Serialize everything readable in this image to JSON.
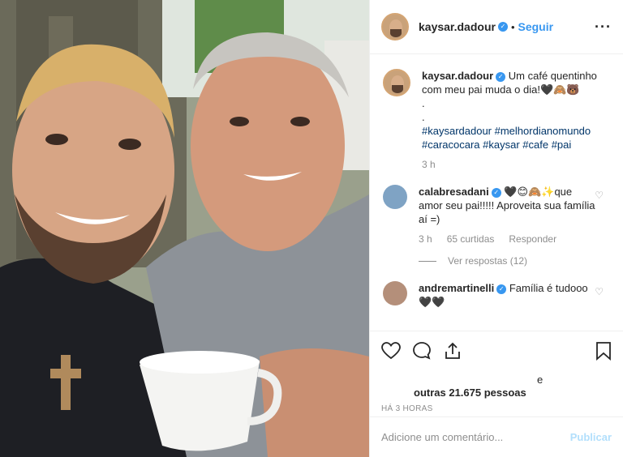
{
  "post": {
    "username": "kaysar.dadour",
    "follow_label": "Seguir",
    "more_icon": "more-icon"
  },
  "caption": {
    "username": "kaysar.dadour",
    "text": "Um café quentinho com meu pai muda o dia!🖤🙈🐻",
    "dots": [
      ".",
      "."
    ],
    "hashtags_line1": "#kaysardadour #melhordianomundo",
    "hashtags_line2": "#caracocara #kaysar #cafe #pai",
    "time": "3 h"
  },
  "comments": [
    {
      "username": "calabresadani",
      "text": "🖤😊🙈✨que amor seu pai!!!!! Aproveita sua família aí =)",
      "time": "3 h",
      "likes": "65 curtidas",
      "reply_label": "Responder",
      "view_replies": "Ver respostas (12)"
    },
    {
      "username": "andremartinelli",
      "text": "Família é tudooo 🖤🖤"
    }
  ],
  "likes": {
    "connector": "e",
    "others": "outras 21.675 pessoas"
  },
  "timestamp": "HÁ 3 HORAS",
  "add_comment": {
    "placeholder": "Adicione um comentário...",
    "publish_label": "Publicar"
  },
  "colors": {
    "link_blue": "#3897f0",
    "hashtag_blue": "#003569",
    "muted": "#8e8e8e",
    "publish_disabled": "#b2dffc"
  }
}
